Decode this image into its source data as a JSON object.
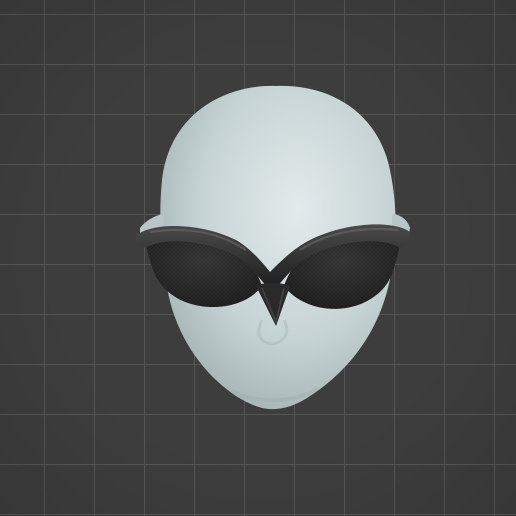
{
  "viewport": {
    "background_color": "#3d3d3d",
    "grid_color": "#555555"
  },
  "model": {
    "head_color": "#c9d5d6",
    "goggles_color": "#262626",
    "icon": "3d-head-with-goggles"
  }
}
